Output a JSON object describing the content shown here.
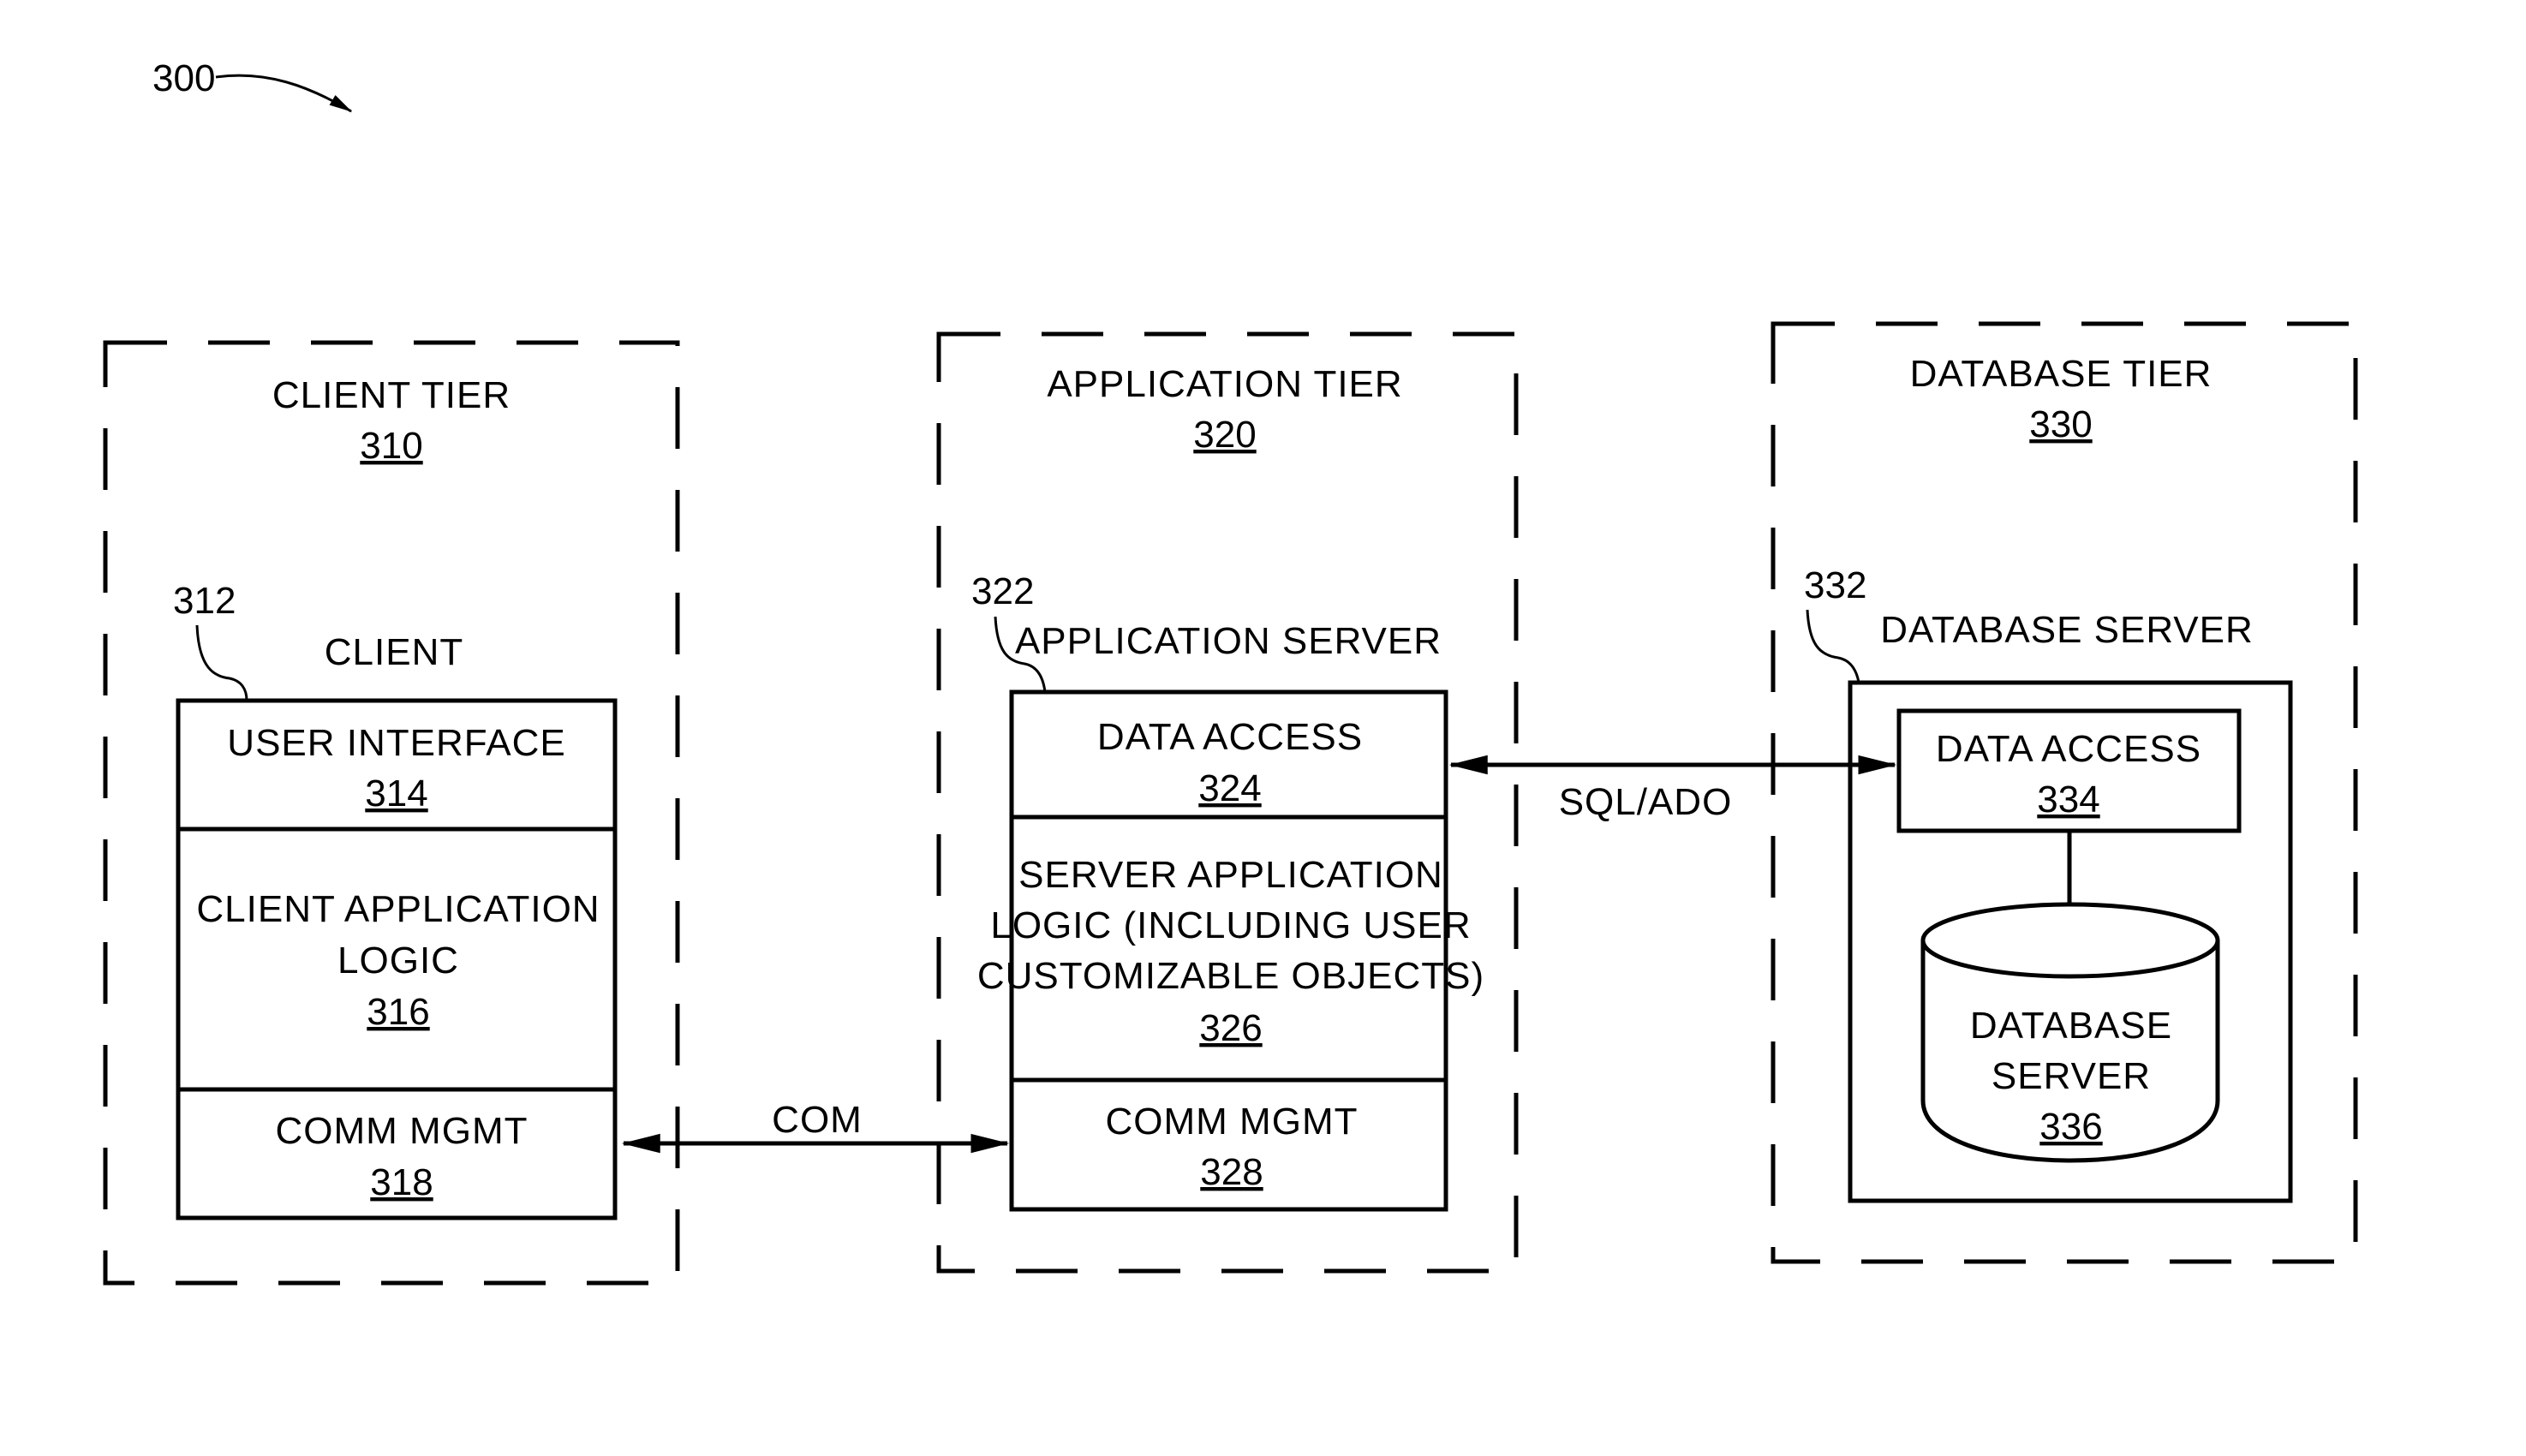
{
  "figure": {
    "ref": "300"
  },
  "tiers": [
    {
      "title": "CLIENT TIER",
      "ref": "310",
      "server": {
        "title": "CLIENT",
        "ref": "312",
        "layers": [
          {
            "lines": [
              "USER INTERFACE"
            ],
            "ref": "314"
          },
          {
            "lines": [
              "CLIENT APPLICATION",
              "LOGIC"
            ],
            "ref": "316"
          },
          {
            "lines": [
              "COMM MGMT"
            ],
            "ref": "318"
          }
        ]
      }
    },
    {
      "title": "APPLICATION TIER",
      "ref": "320",
      "server": {
        "title": "APPLICATION SERVER",
        "ref": "322",
        "layers": [
          {
            "lines": [
              "DATA ACCESS"
            ],
            "ref": "324"
          },
          {
            "lines": [
              "SERVER APPLICATION",
              "LOGIC (INCLUDING USER",
              "CUSTOMIZABLE OBJECTS)"
            ],
            "ref": "326"
          },
          {
            "lines": [
              "COMM MGMT"
            ],
            "ref": "328"
          }
        ]
      }
    },
    {
      "title": "DATABASE TIER",
      "ref": "330",
      "server": {
        "title": "DATABASE SERVER",
        "ref": "332",
        "data_access": {
          "lines": [
            "DATA ACCESS"
          ],
          "ref": "334"
        },
        "database": {
          "lines": [
            "DATABASE",
            "SERVER"
          ],
          "ref": "336"
        }
      }
    }
  ],
  "connections": [
    {
      "label": "COM",
      "from": "318",
      "to": "328",
      "bidirectional": true
    },
    {
      "label": "SQL/ADO",
      "from": "324",
      "to": "334",
      "bidirectional": true
    }
  ]
}
